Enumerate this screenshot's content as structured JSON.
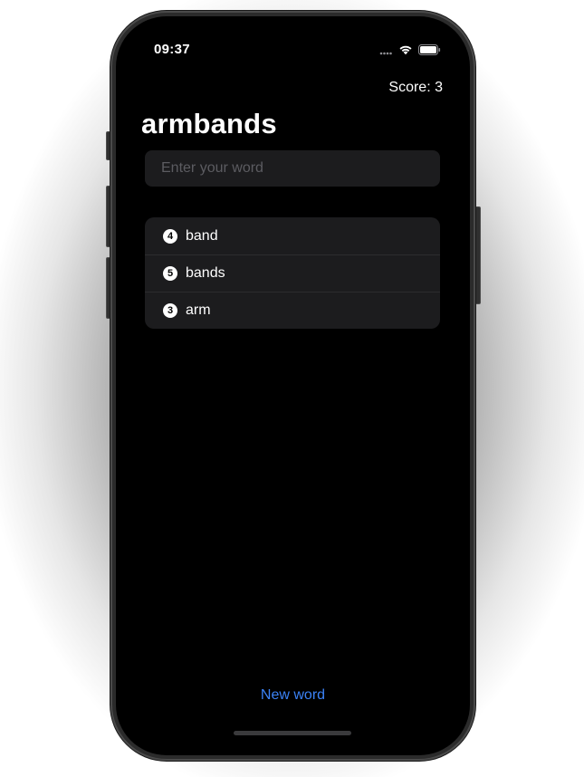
{
  "status_bar": {
    "time": "09:37"
  },
  "header": {
    "score_label": "Score: 3"
  },
  "game": {
    "root_word": "armbands",
    "input": {
      "placeholder": "Enter your word",
      "value": ""
    },
    "used_words": [
      {
        "count": "4",
        "word": "band"
      },
      {
        "count": "5",
        "word": "bands"
      },
      {
        "count": "3",
        "word": "arm"
      }
    ],
    "new_word_label": "New word"
  },
  "colors": {
    "background": "#000000",
    "card": "#1c1c1e",
    "accent": "#3b82f6",
    "text": "#ffffff",
    "placeholder": "#5c5c61"
  },
  "icons": [
    "cellular-signal-icon",
    "wifi-icon",
    "battery-icon",
    "numbered-circle-icon"
  ]
}
